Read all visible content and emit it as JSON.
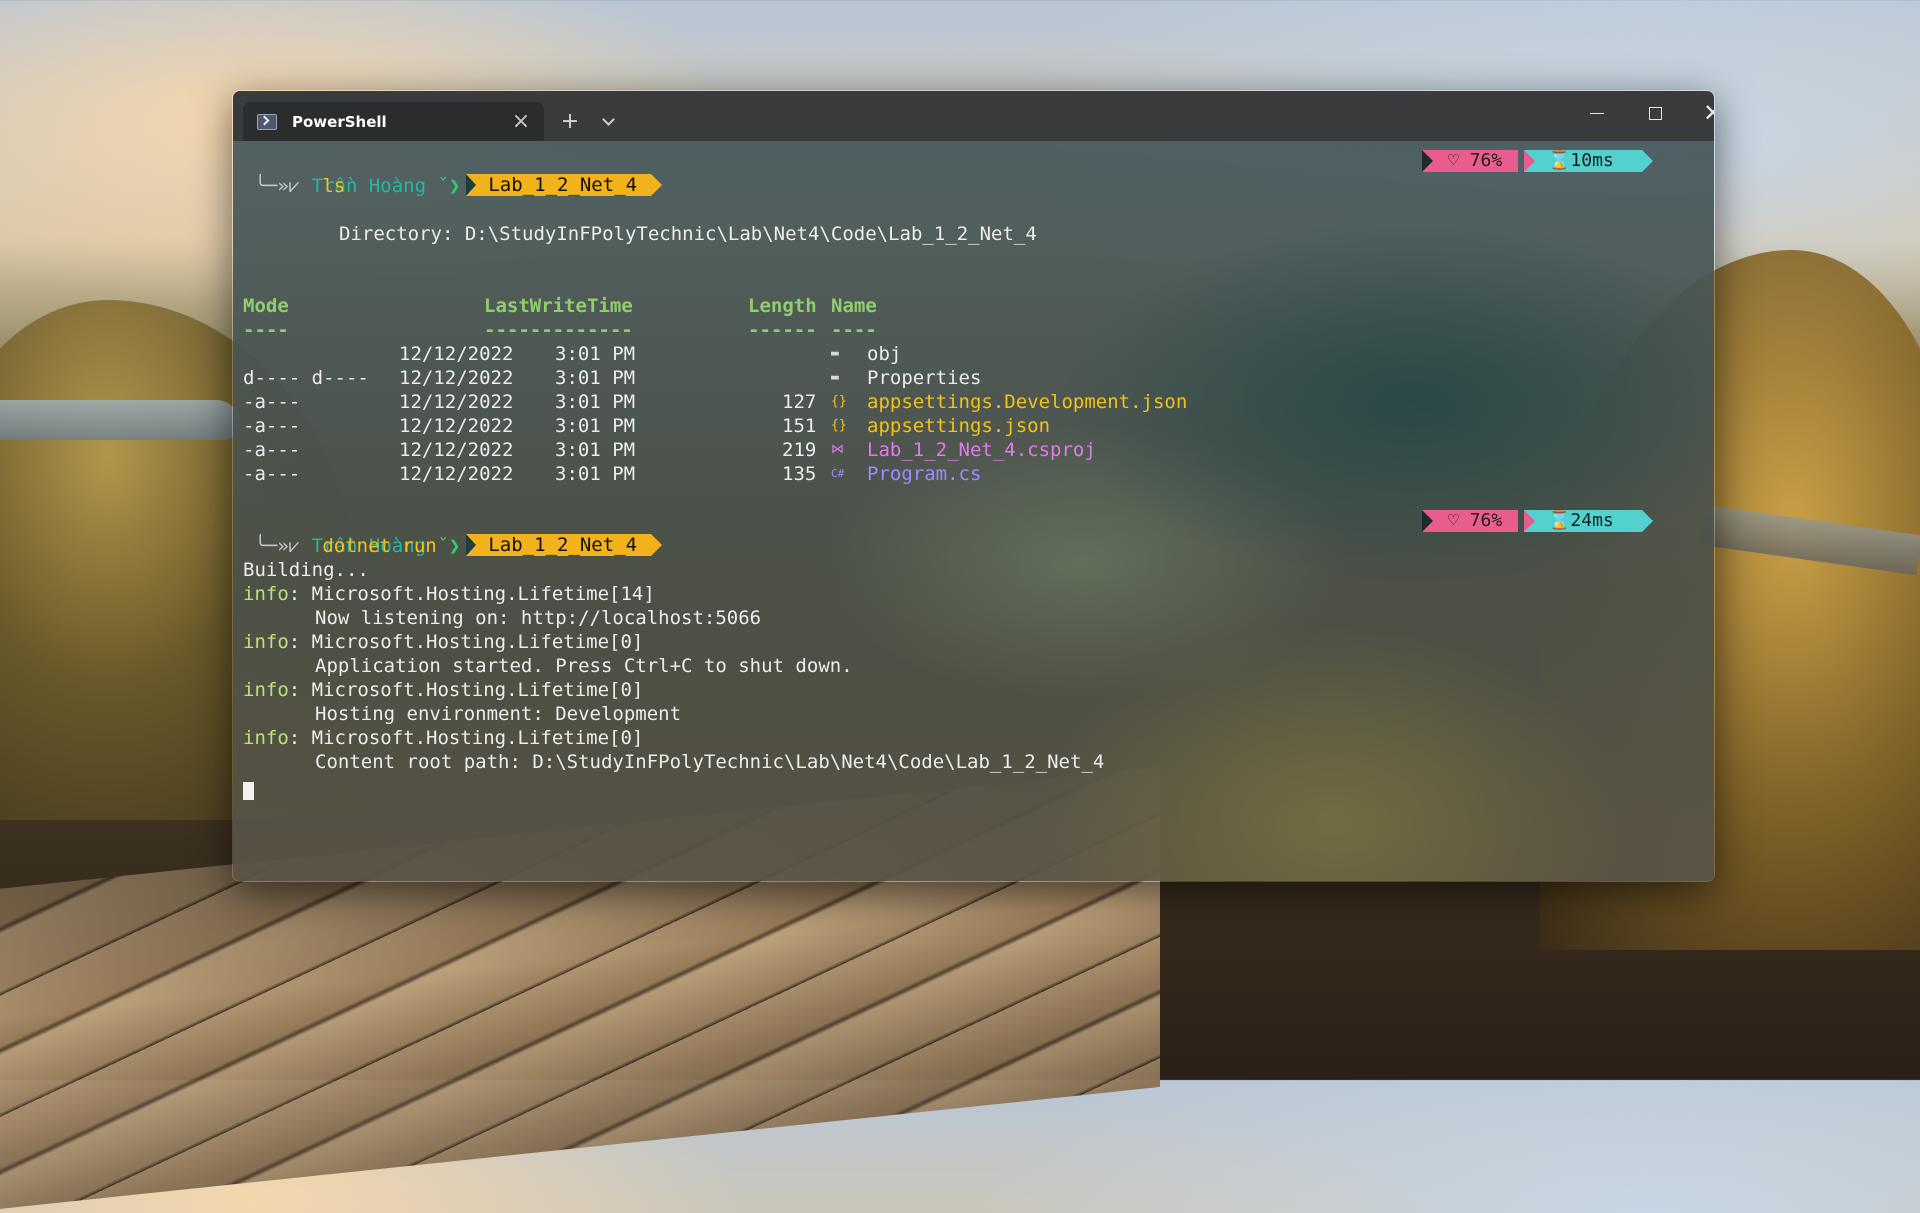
{
  "window": {
    "tab_title": "PowerShell",
    "tab_close": "×",
    "new_tab": "+",
    "window_close": "✕"
  },
  "prompt1": {
    "user": "Trần Hoàng",
    "folder": "Lab_1_2_Net_4",
    "command": "ls",
    "battery": "♡ 76%",
    "duration": "⌛10ms"
  },
  "directory_line": "Directory: D:\\StudyInFPolyTechnic\\Lab\\Net4\\Code\\Lab_1_2_Net_4",
  "table": {
    "headers": [
      "Mode",
      "LastWriteTime",
      "Length",
      "Name"
    ],
    "underline": [
      "----",
      "-------------",
      "------",
      "----"
    ],
    "rows": [
      {
        "mode": "d----",
        "date": "12/12/2022",
        "time": "3:01 PM",
        "length": "",
        "name": "obj",
        "icon": "folder-icon",
        "type": "folder"
      },
      {
        "mode": "d----",
        "date": "12/12/2022",
        "time": "3:01 PM",
        "length": "",
        "name": "Properties",
        "icon": "folder-icon",
        "type": "folder"
      },
      {
        "mode": "-a---",
        "date": "12/12/2022",
        "time": "3:01 PM",
        "length": "127",
        "name": "appsettings.Development.json",
        "icon": "json-icon",
        "type": "json"
      },
      {
        "mode": "-a---",
        "date": "12/12/2022",
        "time": "3:01 PM",
        "length": "151",
        "name": "appsettings.json",
        "icon": "json-icon",
        "type": "json"
      },
      {
        "mode": "-a---",
        "date": "12/12/2022",
        "time": "3:01 PM",
        "length": "219",
        "name": "Lab_1_2_Net_4.csproj",
        "icon": "visual-studio-icon",
        "type": "csproj"
      },
      {
        "mode": "-a---",
        "date": "12/12/2022",
        "time": "3:01 PM",
        "length": "135",
        "name": "Program.cs",
        "icon": "csharp-icon",
        "type": "cs"
      }
    ]
  },
  "prompt2": {
    "user": "Trần Hoàng",
    "folder": "Lab_1_2_Net_4",
    "command": "dotnet run",
    "battery": "♡ 76%",
    "duration": "⌛24ms"
  },
  "output": {
    "building": "Building...",
    "entries": [
      {
        "label": "info",
        "source": ": Microsoft.Hosting.Lifetime[14]",
        "message": "Now listening on: http://localhost:5066"
      },
      {
        "label": "info",
        "source": ": Microsoft.Hosting.Lifetime[0]",
        "message": "Application started. Press Ctrl+C to shut down."
      },
      {
        "label": "info",
        "source": ": Microsoft.Hosting.Lifetime[0]",
        "message": "Hosting environment: Development"
      },
      {
        "label": "info",
        "source": ": Microsoft.Hosting.Lifetime[0]",
        "message": "Content root path: D:\\StudyInFPolyTechnic\\Lab\\Net4\\Code\\Lab_1_2_Net_4"
      }
    ]
  }
}
